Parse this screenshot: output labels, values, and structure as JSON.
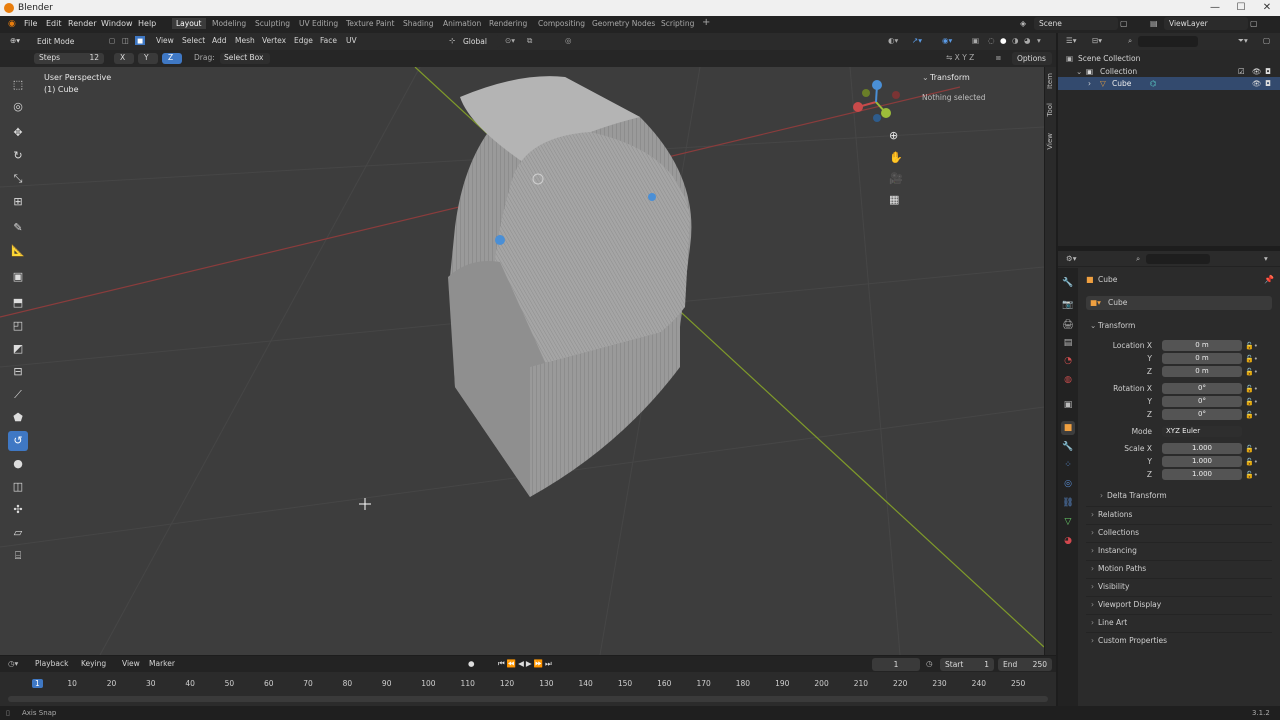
{
  "window": {
    "title": "Blender",
    "controls": [
      "—",
      "☐",
      "✕"
    ]
  },
  "menu": {
    "items": [
      "File",
      "Edit",
      "Render",
      "Window",
      "Help"
    ]
  },
  "workspaces": [
    "Layout",
    "Modeling",
    "Sculpting",
    "UV Editing",
    "Texture Paint",
    "Shading",
    "Animation",
    "Rendering",
    "Compositing",
    "Geometry Nodes",
    "Scripting"
  ],
  "active_workspace": "Layout",
  "add_tab": "+",
  "scene": {
    "name": "Scene",
    "view_layer": "ViewLayer"
  },
  "header": {
    "mode": "Edit Mode",
    "menus": [
      "View",
      "Select",
      "Add",
      "Mesh",
      "Vertex",
      "Edge",
      "Face",
      "UV"
    ],
    "orientation": "Global",
    "options": "Options"
  },
  "op_bar": {
    "steps_label": "Steps",
    "steps_value": "12",
    "axes": [
      "X",
      "Y",
      "Z"
    ],
    "active_axis": "Z",
    "drag_label": "Drag:",
    "drag_value": "Select Box"
  },
  "viewport": {
    "title": "User Perspective",
    "object": "(1) Cube",
    "axis_labels": {
      "x": "X",
      "y": "Y",
      "z": "Z"
    }
  },
  "npanel": {
    "section": "Transform",
    "message": "Nothing selected",
    "tabs": [
      "Item",
      "Tool",
      "View"
    ]
  },
  "outliner": {
    "scene_collection": "Scene Collection",
    "collection": "Collection",
    "object": "Cube"
  },
  "properties": {
    "object_name": "Cube",
    "data_name": "Cube",
    "transform_label": "Transform",
    "location_label": "Location X",
    "rotation_label": "Rotation X",
    "scale_label": "Scale X",
    "axis_y": "Y",
    "axis_z": "Z",
    "location": [
      "0 m",
      "0 m",
      "0 m"
    ],
    "rotation": [
      "0°",
      "0°",
      "0°"
    ],
    "mode_label": "Mode",
    "mode_value": "XYZ Euler",
    "scale": [
      "1.000",
      "1.000",
      "1.000"
    ],
    "delta": "Delta Transform",
    "sections": [
      "Relations",
      "Collections",
      "Instancing",
      "Motion Paths",
      "Visibility",
      "Viewport Display",
      "Line Art",
      "Custom Properties"
    ]
  },
  "timeline": {
    "menus": [
      "Playback",
      "Keying",
      "View",
      "Marker"
    ],
    "current_frame": "1",
    "start_label": "Start",
    "start": "1",
    "end_label": "End",
    "end": "250",
    "ticks": [
      "1",
      "10",
      "20",
      "30",
      "40",
      "50",
      "60",
      "70",
      "80",
      "90",
      "100",
      "110",
      "120",
      "130",
      "140",
      "150",
      "160",
      "170",
      "180",
      "190",
      "200",
      "210",
      "220",
      "230",
      "240",
      "250"
    ]
  },
  "status": {
    "left": "Axis Snap",
    "version": "3.1.2"
  },
  "colors": {
    "accent": "#3f78c4",
    "x_axis": "#c84a4a",
    "y_axis": "#9cbd3a",
    "z_axis": "#4a8fd6"
  }
}
